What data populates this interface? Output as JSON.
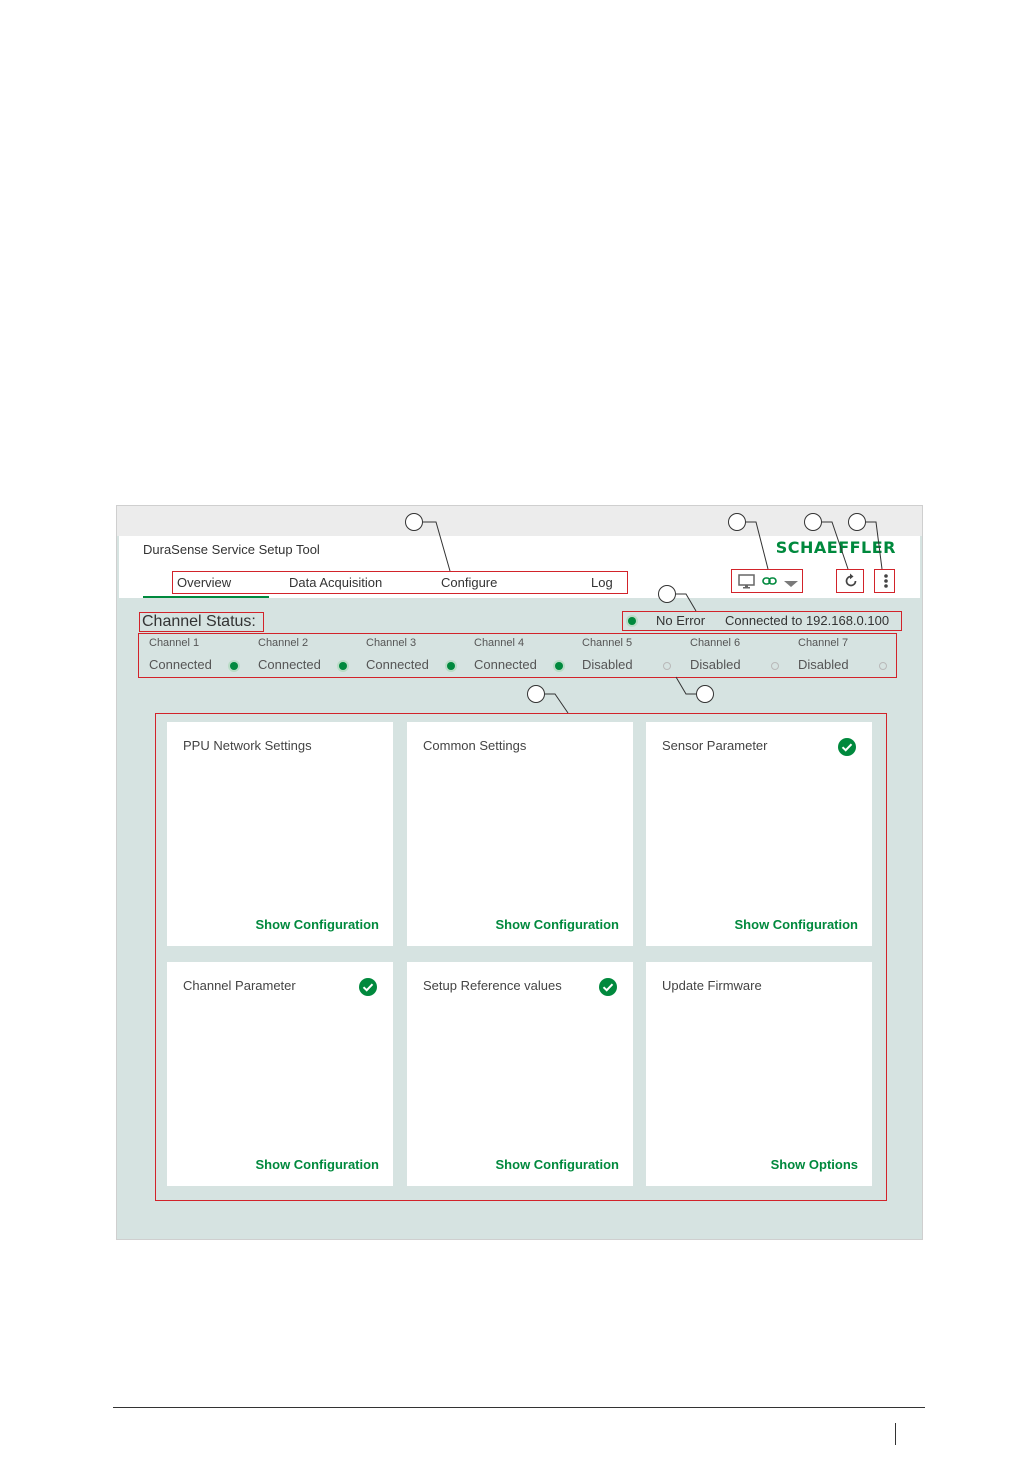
{
  "app": {
    "title": "DuraSense Service Setup Tool",
    "logo": "SCHAEFFLER"
  },
  "tabs": [
    {
      "label": "Overview",
      "active": true
    },
    {
      "label": "Data Acquisition",
      "active": false
    },
    {
      "label": "Configure",
      "active": false
    },
    {
      "label": "Log",
      "active": false
    }
  ],
  "toolbar_icons": [
    "monitor-icon",
    "link-icon",
    "caret-down-icon",
    "refresh-icon",
    "more-vertical-icon"
  ],
  "status": {
    "title": "Channel Status:",
    "error_text": "No Error",
    "connection_text": "Connected to 192.168.0.100"
  },
  "channels": [
    {
      "name": "Channel 1",
      "state": "Connected",
      "active": true
    },
    {
      "name": "Channel 2",
      "state": "Connected",
      "active": true
    },
    {
      "name": "Channel 3",
      "state": "Connected",
      "active": true
    },
    {
      "name": "Channel 4",
      "state": "Connected",
      "active": true
    },
    {
      "name": "Channel 5",
      "state": "Disabled",
      "active": false
    },
    {
      "name": "Channel 6",
      "state": "Disabled",
      "active": false
    },
    {
      "name": "Channel 7",
      "state": "Disabled",
      "active": false
    }
  ],
  "cards": [
    {
      "title": "PPU Network Settings",
      "link": "Show Configuration",
      "checked": false
    },
    {
      "title": "Common Settings",
      "link": "Show Configuration",
      "checked": false
    },
    {
      "title": "Sensor Parameter",
      "link": "Show Configuration",
      "checked": true
    },
    {
      "title": "Channel Parameter",
      "link": "Show Configuration",
      "checked": true
    },
    {
      "title": "Setup Reference values",
      "link": "Show Configuration",
      "checked": true
    },
    {
      "title": "Update Firmware",
      "link": "Show Options",
      "checked": false
    }
  ],
  "colors": {
    "brand": "#00893d",
    "highlight_box": "#d2232a",
    "background": "#d6e3e1"
  }
}
